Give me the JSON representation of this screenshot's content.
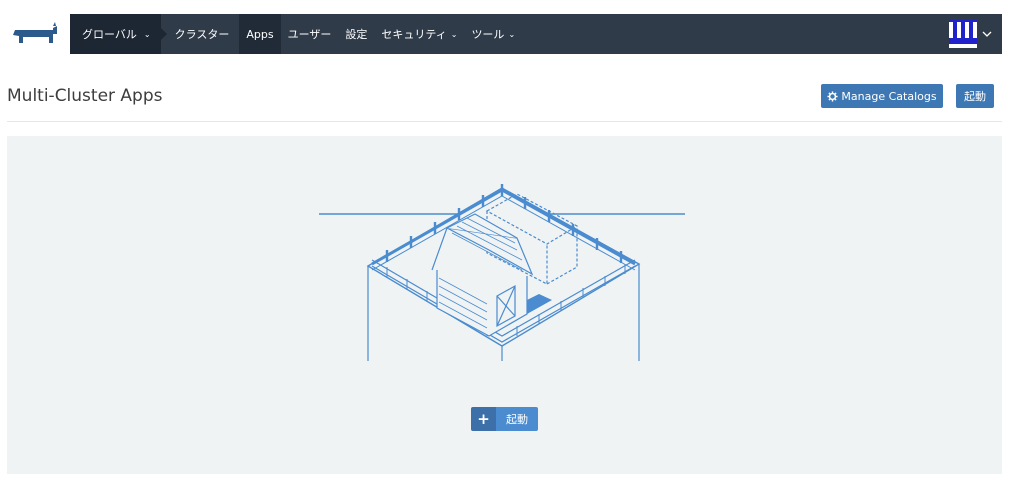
{
  "nav": {
    "global_label": "グローバル",
    "cluster_label": "クラスター",
    "items": [
      {
        "label": "Apps",
        "active": true,
        "dropdown": false
      },
      {
        "label": "ユーザー",
        "active": false,
        "dropdown": false
      },
      {
        "label": "設定",
        "active": false,
        "dropdown": false
      },
      {
        "label": "セキュリティ",
        "active": false,
        "dropdown": true
      },
      {
        "label": "ツール",
        "active": false,
        "dropdown": true
      }
    ]
  },
  "header": {
    "title": "Multi-Cluster Apps",
    "manage_catalogs_label": "Manage Catalogs",
    "launch_label": "起動"
  },
  "empty_state": {
    "launch_label": "起動"
  },
  "icons": {
    "logo": "rancher-logo-icon",
    "gear": "gear-icon",
    "plus": "plus-icon",
    "chevron": "chevron-down-icon",
    "avatar": "avatar-icon",
    "illustration": "barn-farm-illustration"
  },
  "colors": {
    "nav_bg": "#2f3b49",
    "nav_active_bg": "#1d2733",
    "accent": "#3d78b5",
    "panel_bg": "#f0f3f4",
    "illustration_stroke": "#4a8ccf"
  }
}
